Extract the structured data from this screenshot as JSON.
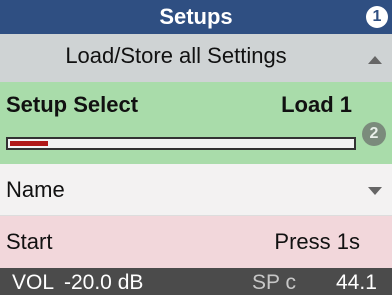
{
  "header": {
    "title": "Setups",
    "badge": "1"
  },
  "section": {
    "label": "Load/Store all Settings"
  },
  "setup_select": {
    "label": "Setup Select",
    "value": "Load 1",
    "badge": "2",
    "progress": 0.11
  },
  "name_row": {
    "label": "Name"
  },
  "start_row": {
    "label": "Start",
    "value": "Press 1s"
  },
  "status": {
    "vol_label": "VOL",
    "vol_value": "-20.0 dB",
    "sp_label": "SP c",
    "sp_value": "44.1"
  },
  "colors": {
    "header_bg": "#2f4f82",
    "section_bg": "#cfd3d4",
    "select_bg": "#a9dcaa",
    "progress_fill": "#b01717",
    "start_bg": "#f2d7db",
    "status_bg": "#4b4b4b"
  },
  "icons": {
    "up": "chevron-up-icon",
    "down": "chevron-down-icon"
  }
}
